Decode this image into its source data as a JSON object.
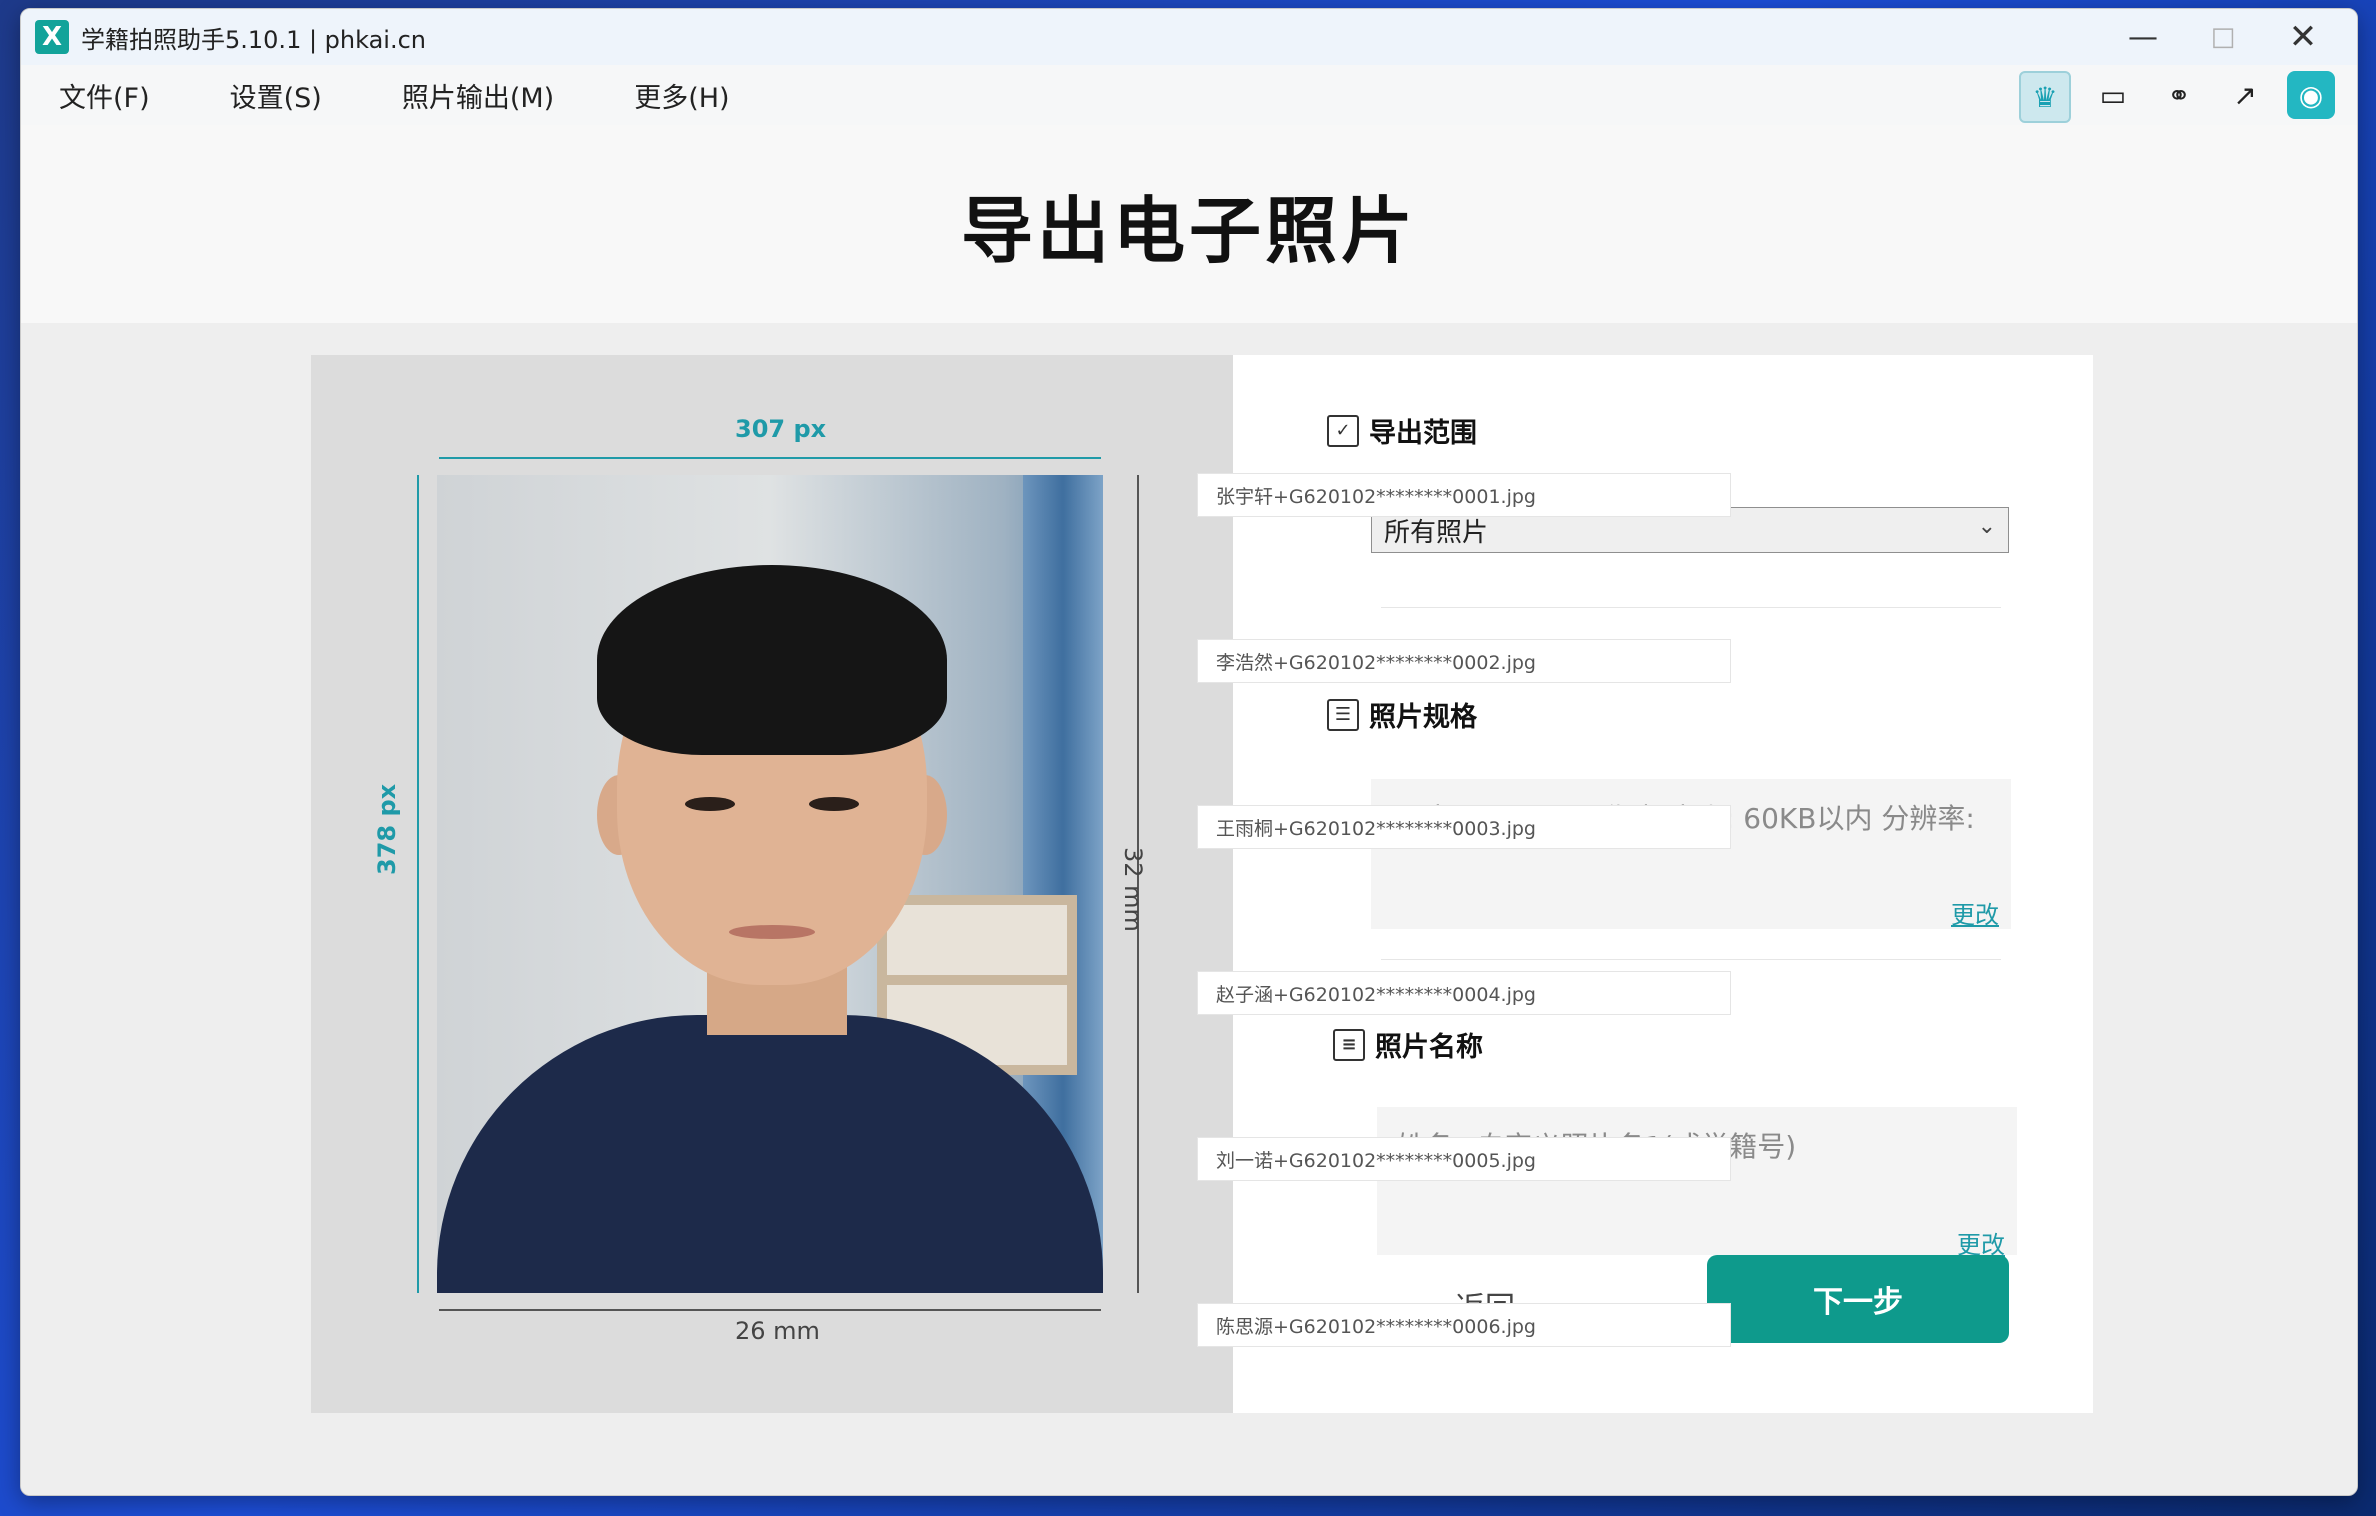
{
  "window": {
    "title": "学籍拍照助手5.10.1 | phkai.cn",
    "app_icon_label": "X"
  },
  "menu": {
    "items": [
      "文件(F)",
      "设置(S)",
      "照片输出(M)",
      "更多(H)"
    ]
  },
  "toolbar": {
    "icons": [
      "crown-icon",
      "tablet-icon",
      "link-icon",
      "share-icon",
      "wechat-icon"
    ]
  },
  "header": {
    "title": "导出电子照片"
  },
  "preview": {
    "width_px_label": "307 px",
    "height_px_label": "378 px",
    "width_mm_label": "26 mm",
    "height_mm_label": "32 mm"
  },
  "settings": {
    "export_range_title": "导出范围",
    "export_range_value": "所有照片",
    "photo_spec_title": "照片规格",
    "photo_spec_text": "尺寸: 307 * 378像素  大小: 60KB以内  分辨率:",
    "photo_spec_change": "更改",
    "photo_name_title": "照片名称",
    "photo_name_text": "姓名+自定义照片名1(或学籍号)",
    "photo_name_change": "更改",
    "back_label": "返回",
    "next_label": "下一步"
  },
  "file_list": [
    "张宇轩+G620102********0001.jpg",
    "李浩然+G620102********0002.jpg",
    "王雨桐+G620102********0003.jpg",
    "赵子涵+G620102********0004.jpg",
    "刘一诺+G620102********0005.jpg",
    "陈思源+G620102********0006.jpg"
  ],
  "colors": {
    "accent": "#0e9a8c",
    "dimension": "#1f9aa8"
  }
}
